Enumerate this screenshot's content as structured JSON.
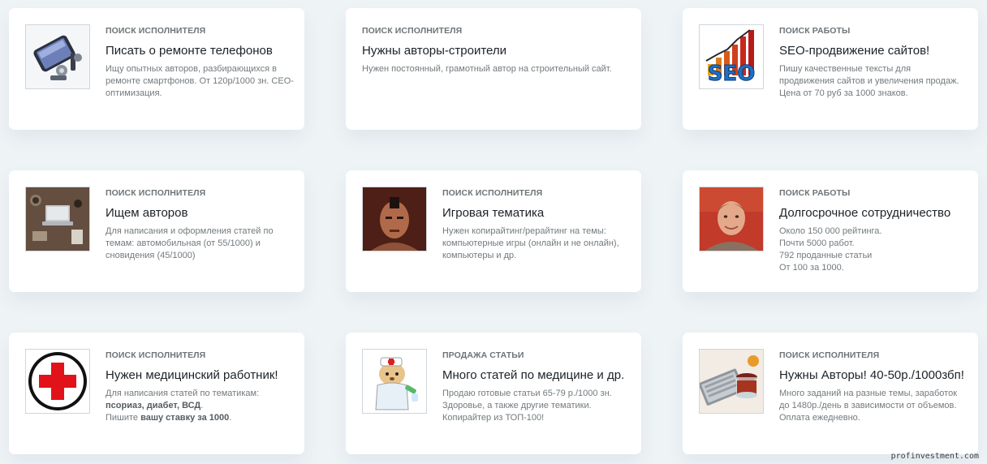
{
  "cards": [
    {
      "category": "ПОИСК ИСПОЛНИТЕЛЯ",
      "title": "Писать о ремонте телефонов",
      "desc": "Ищу опытных авторов, разбирающихся в ремонте смартфонов. От 120р/1000 зн. СЕО-оптимизация.",
      "image": "phone-repair-image"
    },
    {
      "category": "ПОИСК ИСПОЛНИТЕЛЯ",
      "title": "Нужны авторы-строители",
      "desc": "Нужен постоянный, грамотный автор на строительный сайт."
    },
    {
      "category": "ПОИСК РАБОТЫ",
      "title": "SEO-продвижение сайтов!",
      "desc": "Пишу качественные тексты для продвижения сайтов и увеличения продаж. Цена от 70 руб за 1000 знаков.",
      "image": "seo-image"
    },
    {
      "category": "ПОИСК ИСПОЛНИТЕЛЯ",
      "title": "Ищем авторов",
      "desc": "Для написания и оформления статей по темам: автомобильная (от 55/1000) и сновидения (45/1000)",
      "image": "laptop-desk-image"
    },
    {
      "category": "ПОИСК ИСПОЛНИТЕЛЯ",
      "title": "Игровая тематика",
      "desc": "Нужен копирайтинг/рерайтинг на темы: компьютерные игры (онлайн и не онлайн), компьютеры и др.",
      "image": "game-character-image"
    },
    {
      "category": "ПОИСК РАБОТЫ",
      "title": "Долгосрочное сотрудничество",
      "desc_lines": [
        "Около 150 000 рейтинга.",
        "Почти 5000 работ.",
        "792 проданные статьи",
        "От 100 за 1000."
      ],
      "image": "man-portrait-image"
    },
    {
      "category": "ПОИСК ИСПОЛНИТЕЛЯ",
      "title": "Нужен медицинский работник!",
      "desc_intro": "Для написания статей по тематикам:",
      "desc_topics": "псориаз, диабет, ВСД",
      "desc_dot": ".",
      "desc_ask": "Пишите ",
      "desc_rate": "вашу ставку за 1000",
      "desc_end": ".",
      "image": "red-cross-image"
    },
    {
      "category": "ПРОДАЖА СТАТЬИ",
      "title": "Много статей по медицине и др.",
      "desc": "Продаю готовые статьи 65-79 р./1000 зн. Здоровье, а также другие тематики. Копирайтер из ТОП-100!",
      "image": "doctor-bear-image"
    },
    {
      "category": "ПОИСК ИСПОЛНИТЕЛЯ",
      "title": "Нужны Авторы! 40-50р./1000збп!",
      "desc": "Много заданий на разные темы, заработок до 1480р./день в зависимости от объемов. Оплата ежедневно.",
      "image": "laptop-tea-image"
    }
  ],
  "watermark": "profinvestment.com"
}
